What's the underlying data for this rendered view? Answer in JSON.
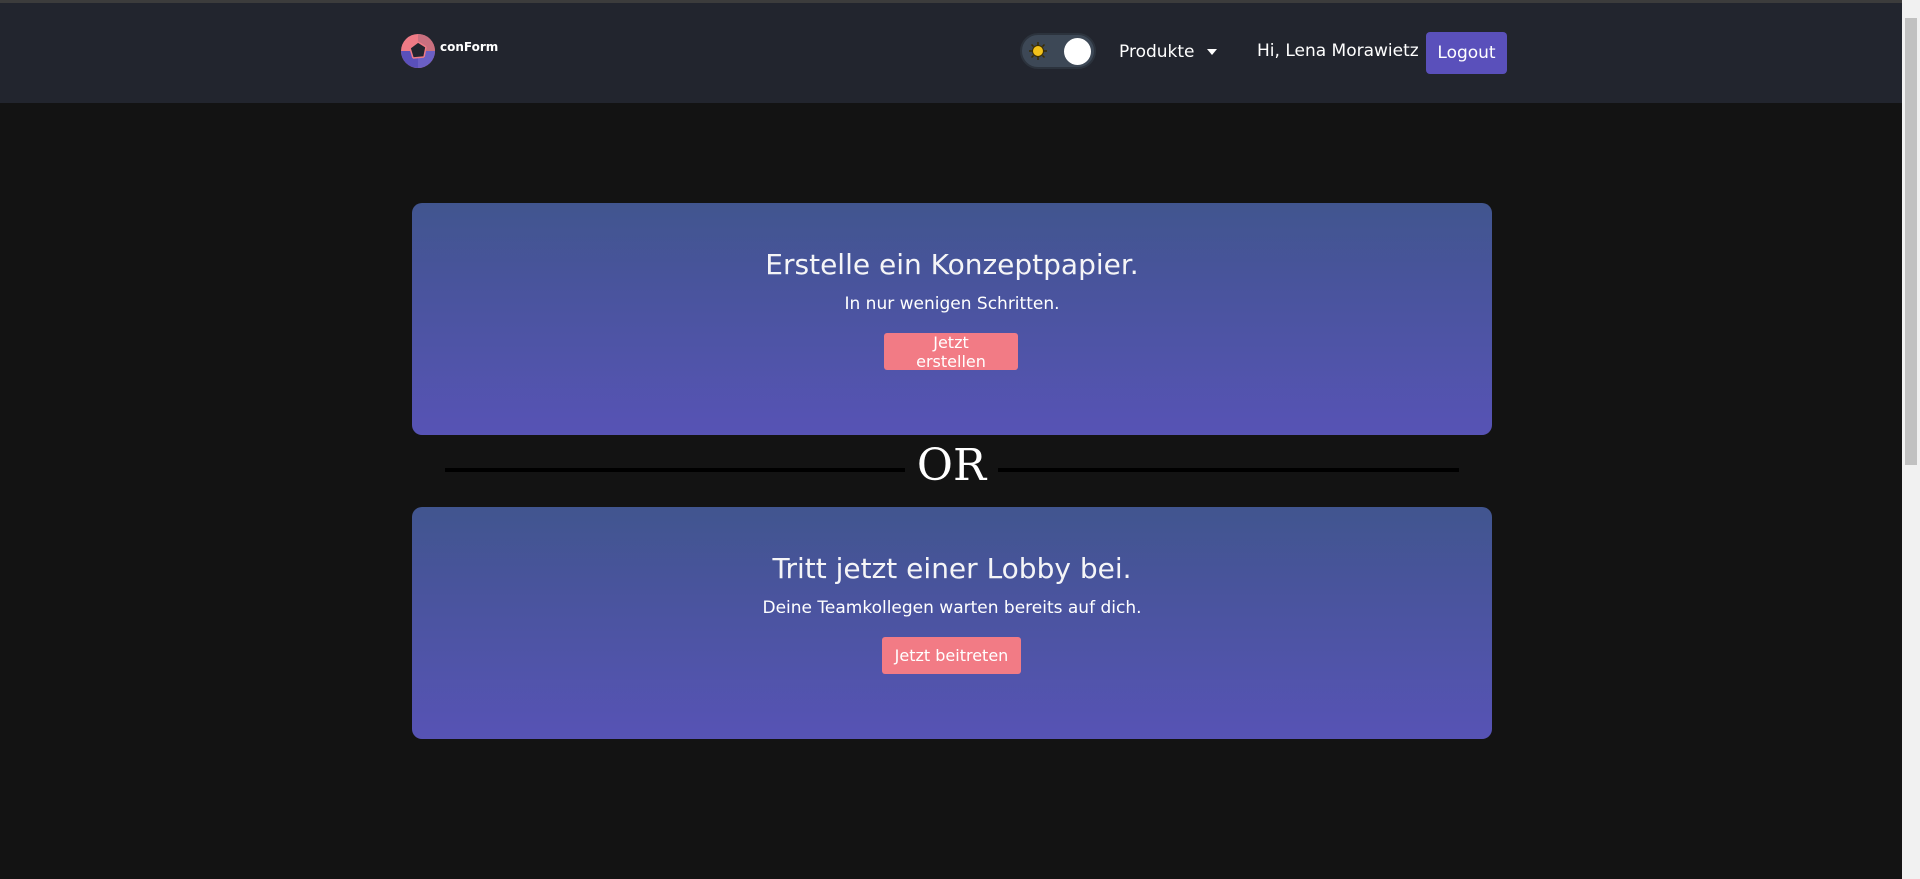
{
  "brand": {
    "name": "conForm"
  },
  "nav": {
    "theme_toggle_state": "light",
    "products_label": "Produkte",
    "greeting": "Hi, Lena Morawietz",
    "logout_label": "Logout"
  },
  "cards": [
    {
      "title": "Erstelle ein Konzeptpapier.",
      "subtitle": "In nur wenigen Schritten.",
      "button": "Jetzt erstellen"
    },
    {
      "title": "Tritt jetzt einer Lobby bei.",
      "subtitle": "Deine Teamkollegen warten bereits auf dich.",
      "button": "Jetzt beitreten"
    }
  ],
  "divider": {
    "text": "OR"
  },
  "colors": {
    "accent": "#5a50bb",
    "card_button": "#f27b85",
    "background": "#131313",
    "navbar": "#22252e"
  }
}
